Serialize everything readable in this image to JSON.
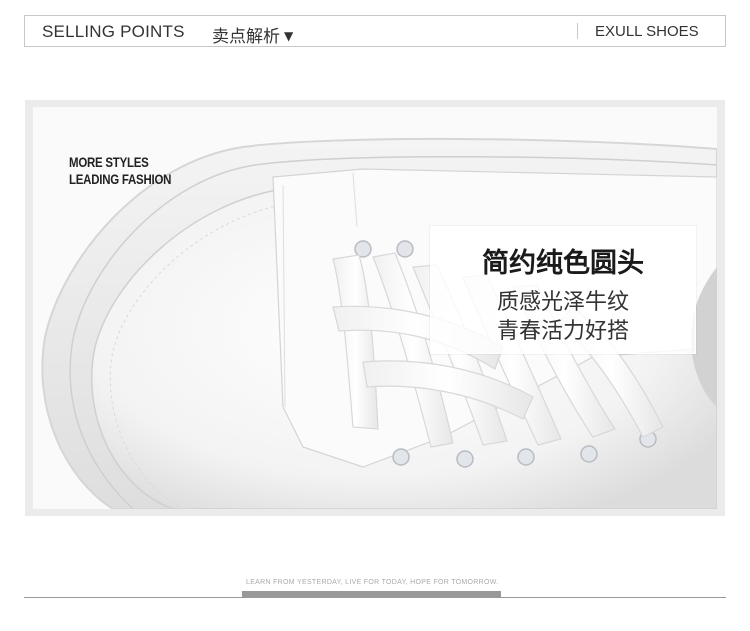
{
  "header": {
    "title": "SELLING POINTS",
    "subtitle": "卖点解析",
    "subtitle_arrow": "▼",
    "brand": "EXULL SHOES"
  },
  "photo": {
    "tagline_line1": "MORE STYLES",
    "tagline_line2": "LEADING FASHION",
    "caption_main": "简约纯色圆头",
    "caption_line1": "质感光泽牛纹",
    "caption_line2": "青春活力好搭"
  },
  "footer": {
    "text": "LEARN FROM YESTERDAY, LIVE FOR TODAY, HOPE FOR TOMORROW."
  },
  "colors": {
    "frame": "#ebebeb",
    "header_border": "#c8c8c8",
    "footer_bar": "#999999"
  }
}
